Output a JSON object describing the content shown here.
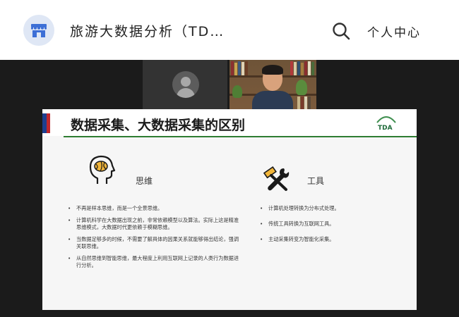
{
  "header": {
    "app_title": "旅游大数据分析（TD…",
    "search_icon": "search-icon",
    "personal_center": "个人中心",
    "store_icon": "store-icon"
  },
  "video": {
    "participant_placeholder_icon": "avatar-icon",
    "presenter_icon": "presenter-video"
  },
  "slide": {
    "title": "数据采集、大数据采集的区别",
    "logo_text": "TDA",
    "left_section": {
      "icon": "brain-head-icon",
      "label": "思维",
      "bullets": [
        "不再是样本思维，而是一个全景思维。",
        "计算机科学在大数据出现之前，非常依赖模型以及算法。实际上这是精准思维模式，大数据时代更依赖于模糊思维。",
        "当数据足够多的时候，不需要了解具体的因果关系就能够得出结论，强调关联思维。",
        "从自然思维到智能思维，最大程度上利用互联网上记录的人类行为数据进行分析。"
      ]
    },
    "right_section": {
      "icon": "tools-icon",
      "label": "工具",
      "bullets": [
        "计算机处理转换为分布式处理。",
        "传统工具转换为互联网工具。",
        "主动采集转变为智能化采集。"
      ]
    }
  }
}
